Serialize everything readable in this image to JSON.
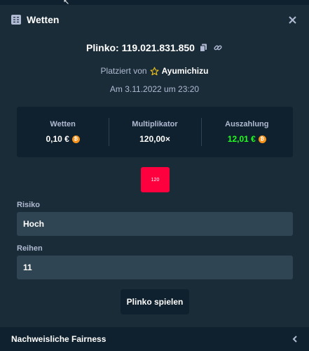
{
  "header": {
    "title": "Wetten",
    "icon": "bet-slip-icon",
    "close_icon": "close-icon"
  },
  "game": {
    "id_text": "Plinko: 119.021.831.850",
    "copy_icon": "copy-icon",
    "link_icon": "link-icon"
  },
  "placed": {
    "prefix": "Platziert von",
    "user": "Ayumichizu",
    "user_icon": "star-icon"
  },
  "date": "Am 3.11.2022 um 23:20",
  "stats": {
    "bet_label": "Wetten",
    "bet_value": "0,10 €",
    "multiplier_label": "Multiplikator",
    "multiplier_value": "120,00×",
    "payout_label": "Auszahlung",
    "payout_value": "12,01 €",
    "coin_icon": "bitcoin-icon",
    "payout_color": "#1fff20"
  },
  "slot": {
    "value": "120",
    "color": "#ff003f"
  },
  "risk": {
    "label": "Risiko",
    "value": "Hoch"
  },
  "rows": {
    "label": "Reihen",
    "value": "11"
  },
  "play_button": "Plinko spielen",
  "footer": {
    "label": "Nachweisliche Fairness",
    "icon": "chevron-left-icon"
  }
}
